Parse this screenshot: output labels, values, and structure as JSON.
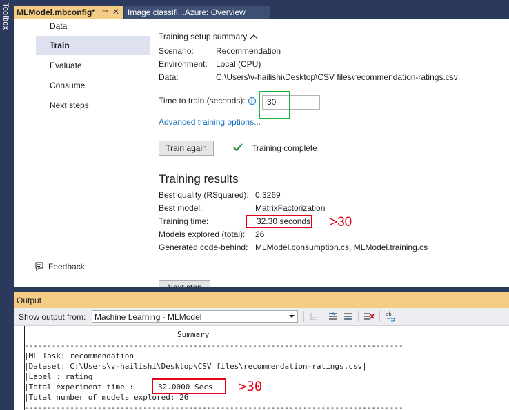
{
  "toolbox": {
    "label": "Toolbox"
  },
  "tabs": {
    "active": {
      "label": "MLModel.mbconfig*",
      "pin_glyph": "⊸",
      "close_glyph": "✕"
    },
    "inactive": {
      "label": "Image classifi...Azure: Overview"
    }
  },
  "nav": {
    "items": [
      {
        "label": "Data"
      },
      {
        "label": "Train"
      },
      {
        "label": "Evaluate"
      },
      {
        "label": "Consume"
      },
      {
        "label": "Next steps"
      }
    ],
    "selected_index": 1,
    "feedback": {
      "label": "Feedback"
    }
  },
  "summary": {
    "heading": "Training setup summary",
    "rows": [
      {
        "label": "Scenario:",
        "value": "Recommendation"
      },
      {
        "label": "Environment:",
        "value": "Local (CPU)"
      },
      {
        "label": "Data:",
        "value": "C:\\Users\\v-hailishi\\Desktop\\CSV files\\recommendation-ratings.csv"
      }
    ]
  },
  "train": {
    "time_label": "Time to train (seconds):",
    "info_glyph": "i",
    "time_value": "30",
    "advanced_link": "Advanced training options...",
    "train_again_label": "Train again",
    "status": "Training complete",
    "next_step_label": "Next step"
  },
  "results": {
    "title": "Training results",
    "rows": [
      {
        "label": "Best quality (RSquared):",
        "value": "0.3269"
      },
      {
        "label": "Best model:",
        "value": "MatrixFactorization"
      },
      {
        "label": "Training time:",
        "value": "32.30 seconds"
      },
      {
        "label": "Models explored (total):",
        "value": "26"
      },
      {
        "label": "Generated code-behind:",
        "value": "MLModel.consumption.cs, MLModel.training.cs"
      }
    ],
    "annotation": ">30"
  },
  "output": {
    "title": "Output",
    "show_from_label": "Show output from:",
    "source": "Machine Learning - MLModel",
    "console": {
      "title": "Summary",
      "task_line": "ML Task: recommendation",
      "dataset_line": "Dataset: C:\\Users\\v-hailishi\\Desktop\\CSV files\\recommendation-ratings.csv",
      "label_line": "Label : rating",
      "time_label": "Total experiment time :",
      "time_value": "32.0000 Secs",
      "models_line": "Total number of models explored: 26"
    },
    "annotation": ">30"
  },
  "colors": {
    "chrome": "#2b3a5c",
    "active_tab": "#f5cc84",
    "highlight_green": "#1fb336",
    "highlight_red": "#e3001b",
    "link": "#0e70c0"
  }
}
